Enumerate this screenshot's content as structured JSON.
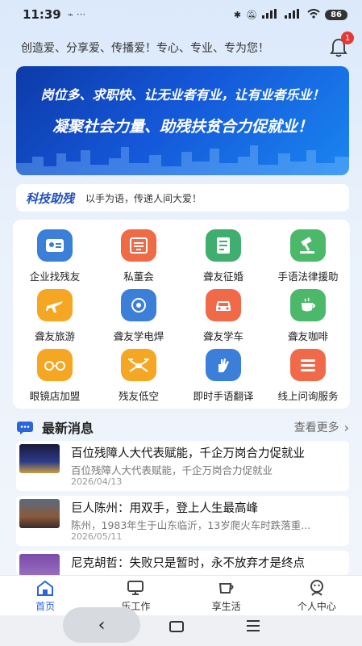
{
  "status": {
    "time": "11:39",
    "battery": "86"
  },
  "header": {
    "slogan": "创造爱、分享爱、传播爱！专心、专业、专为您！",
    "notification_count": "1"
  },
  "banner": {
    "line1": "岗位多、求职快、让无业者有业，让有业者乐业！",
    "line2": "凝聚社会力量、助残扶贫合力促就业！"
  },
  "science": {
    "title": "科技助残",
    "subtitle": "以手为语，传递人间大爱！"
  },
  "services": [
    {
      "label": "企业找残友",
      "icon": "id-card-icon",
      "color": "#3b7fd8"
    },
    {
      "label": "私董会",
      "icon": "building-icon",
      "color": "#ef6b45"
    },
    {
      "label": "聋友征婚",
      "icon": "profile-card-icon",
      "color": "#3fae6e"
    },
    {
      "label": "手语法律援助",
      "icon": "gavel-icon",
      "color": "#4cb86a"
    },
    {
      "label": "聋友旅游",
      "icon": "airplane-icon",
      "color": "#f5a623"
    },
    {
      "label": "聋友学电焊",
      "icon": "welding-icon",
      "color": "#3b7fd8"
    },
    {
      "label": "聋友学车",
      "icon": "car-icon",
      "color": "#f06a4a"
    },
    {
      "label": "聋友咖啡",
      "icon": "coffee-icon",
      "color": "#4cb86a"
    },
    {
      "label": "眼镜店加盟",
      "icon": "glasses-icon",
      "color": "#f5a623"
    },
    {
      "label": "残友低空",
      "icon": "drone-icon",
      "color": "#f5a623"
    },
    {
      "label": "即时手语翻译",
      "icon": "sign-language-icon",
      "color": "#3b7fd8"
    },
    {
      "label": "线上问询服务",
      "icon": "list-icon",
      "color": "#f06a4a"
    }
  ],
  "news": {
    "title": "最新消息",
    "more": "查看更多",
    "items": [
      {
        "headline": "百位残障人大代表赋能，千企万岗合力促就业",
        "summary": "百位残障人大代表赋能，千企万岗合力促就业",
        "date": "2026/04/13"
      },
      {
        "headline": "巨人陈州：用双手，登上人生最高峰",
        "summary": "陈州，1983年生于山东临沂，13岁爬火车时跌落重...",
        "date": "2026/05/11"
      },
      {
        "headline": "尼克胡哲：失败只是暂时，永不放弃才是终点",
        "summary": "",
        "date": ""
      }
    ]
  },
  "tabs": [
    {
      "label": "首页",
      "icon": "home-icon"
    },
    {
      "label": "乐工作",
      "icon": "monitor-icon"
    },
    {
      "label": "享生活",
      "icon": "cup-icon"
    },
    {
      "label": "个人中心",
      "icon": "user-icon"
    }
  ],
  "colors": {
    "accent": "#2a66d9",
    "banner": "#1457d8",
    "badge": "#e53935"
  }
}
